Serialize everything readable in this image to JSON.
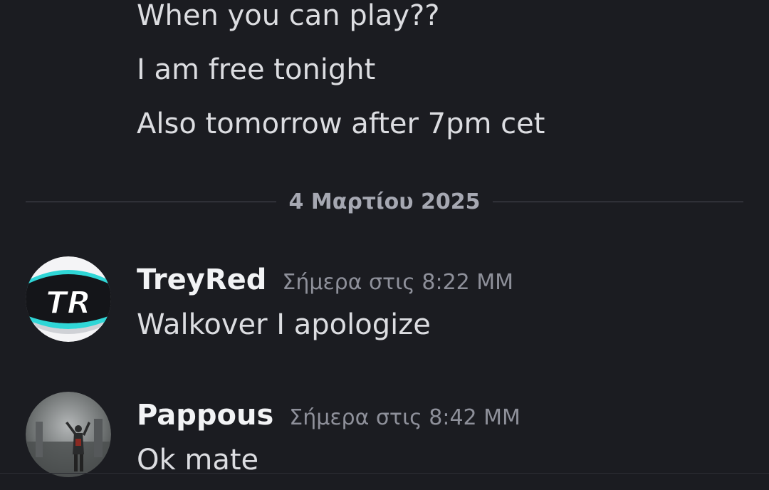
{
  "continued_messages": [
    "When you can play??",
    "I am free tonight",
    "Also tomorrow after 7pm cet"
  ],
  "date_divider": "4 Μαρτίου 2025",
  "messages": [
    {
      "author": "TreyRed",
      "timestamp": "Σήμερα στις 8:22 ΜΜ",
      "text": "Walkover I apologize",
      "avatar_logo_text": "TR"
    },
    {
      "author": "Pappous",
      "timestamp": "Σήμερα στις 8:42 ΜΜ",
      "text": "Ok mate"
    }
  ],
  "colors": {
    "background": "#1b1c21",
    "text": "#dcdde1",
    "author": "#f2f3f5",
    "muted": "#8e909a",
    "logo_accent": "#2fd6d6"
  }
}
